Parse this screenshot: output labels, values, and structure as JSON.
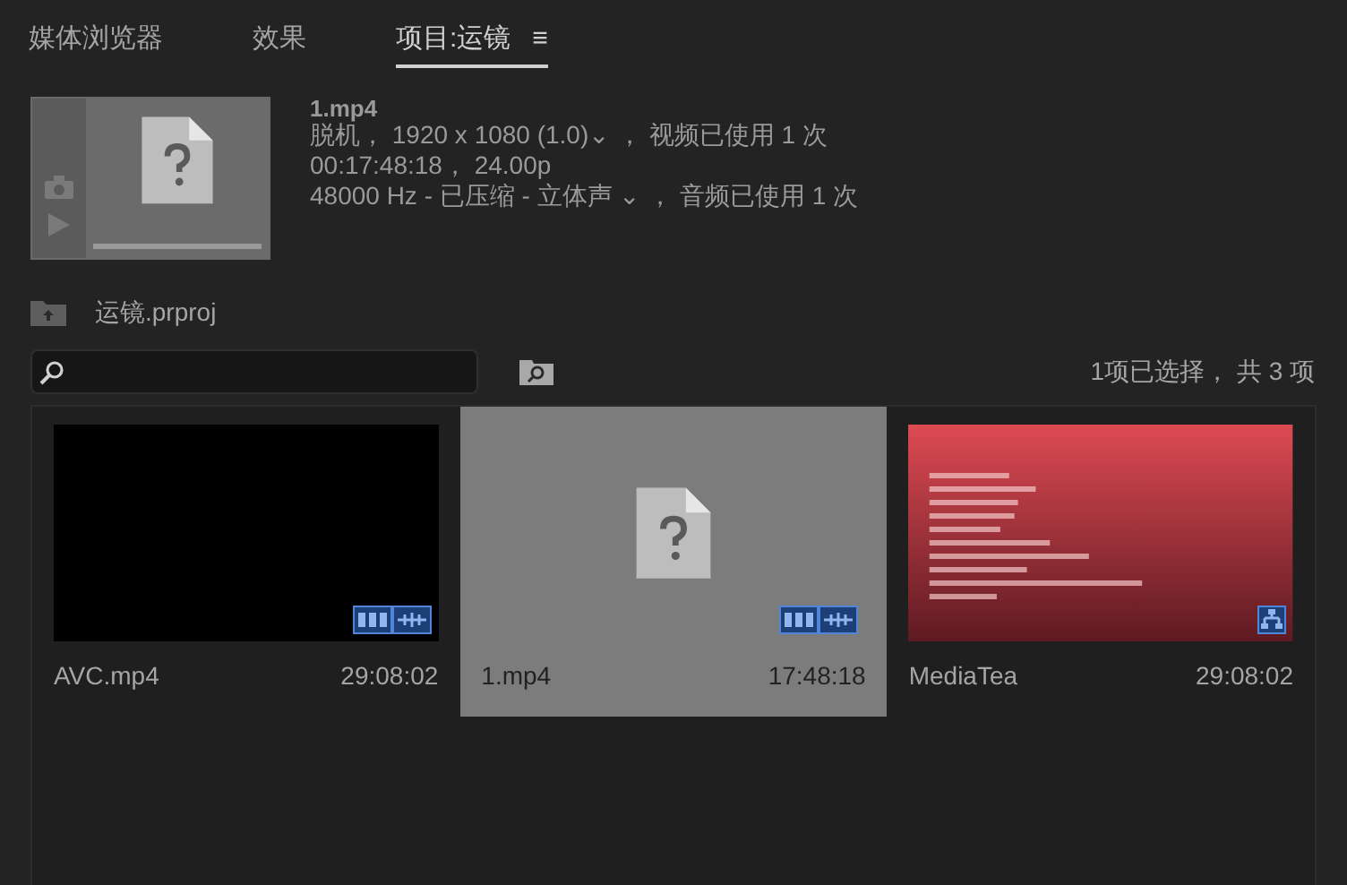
{
  "tabs": [
    {
      "label": "媒体浏览器",
      "selected": false
    },
    {
      "label": "效果",
      "selected": false
    },
    {
      "label": "项目:运镜",
      "selected": true
    }
  ],
  "tab_menu": "≡",
  "preview": {
    "name": "1.mp4",
    "lines": [
      "脱机， 1920 x 1080 (1.0)⌄ ， 视频已使用 1 次",
      "00:17:48:18， 24.00p",
      "48000 Hz - 已压缩 - 立体声 ⌄ ， 音频已使用 1 次"
    ]
  },
  "project": {
    "name": "运镜.prproj"
  },
  "selection_count": "1项已选择， 共 3 项",
  "items": [
    {
      "name": "AVC.mp4",
      "duration": "29:08:02",
      "thumbnail": {
        "kind": "black"
      },
      "badge": {
        "kind": "av"
      },
      "selected": false
    },
    {
      "name": "1.mp4",
      "duration": "17:48:18",
      "thumbnail": {
        "kind": "missing"
      },
      "badge": {
        "kind": "av"
      },
      "selected": true
    },
    {
      "name": "MediaTea",
      "duration": "29:08:02",
      "thumbnail": {
        "kind": "offline"
      },
      "badge": {
        "kind": "offline"
      },
      "selected": false
    }
  ]
}
